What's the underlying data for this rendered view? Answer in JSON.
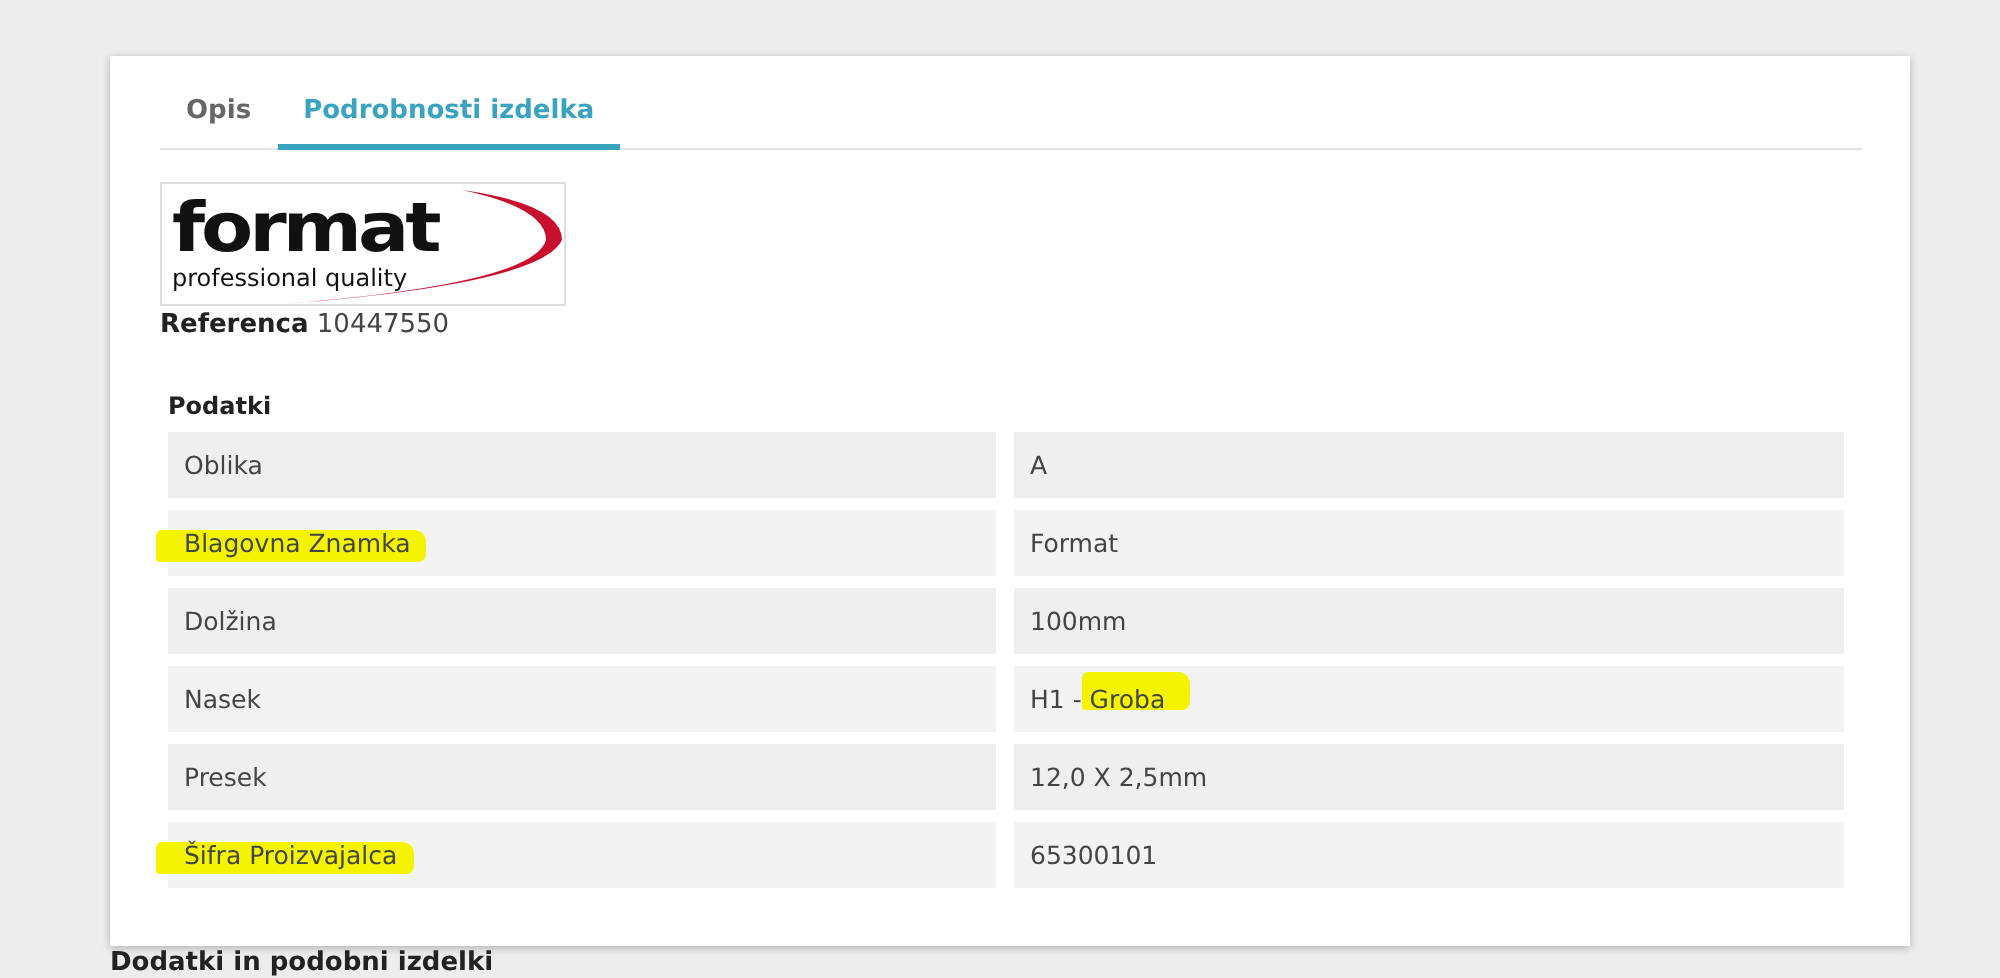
{
  "tabs": [
    {
      "label": "Opis",
      "selected": false
    },
    {
      "label": "Podrobnosti izdelka",
      "selected": true
    }
  ],
  "logo": {
    "wordmark": "format",
    "tagline": "professional quality"
  },
  "reference": {
    "label": "Referenca",
    "value": "10447550"
  },
  "table": {
    "title": "Podatki",
    "rows": [
      {
        "label": "Oblika",
        "value": "A",
        "label_marked": false,
        "value_marked": false
      },
      {
        "label": "Blagovna Znamka",
        "value": "Format",
        "label_marked": true,
        "value_marked": false
      },
      {
        "label": "Dolžina",
        "value": "100mm",
        "label_marked": false,
        "value_marked": false
      },
      {
        "label": "Nasek",
        "value": "H1 - Groba",
        "label_marked": false,
        "value_marked": true
      },
      {
        "label": "Presek",
        "value": "12,0 X 2,5mm",
        "label_marked": false,
        "value_marked": false
      },
      {
        "label": "Šifra Proizvajalca",
        "value": "65300101",
        "label_marked": true,
        "value_marked": false
      }
    ]
  },
  "section_heading": "Dodatki in podobni izdelki"
}
